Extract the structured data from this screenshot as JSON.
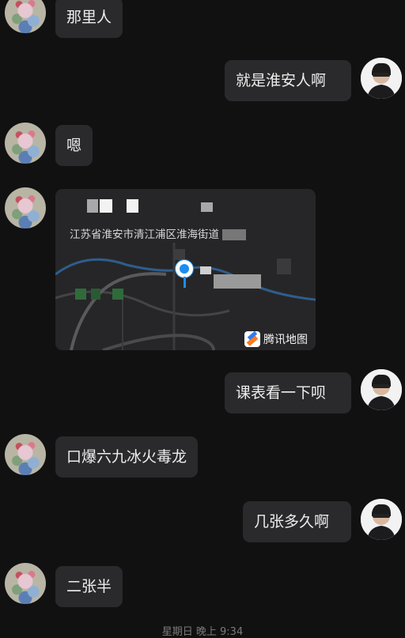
{
  "messages": [
    {
      "side": "left",
      "text": "那里人"
    },
    {
      "side": "right",
      "text": "就是淮安人啊"
    },
    {
      "side": "left",
      "text": "嗯"
    },
    {
      "side": "left",
      "type": "location",
      "address": "江苏省淮安市清江浦区淮海街道",
      "provider": "腾讯地图"
    },
    {
      "side": "right",
      "text": "课表看一下呗"
    },
    {
      "side": "left",
      "text": "口爆六九冰火毒龙"
    },
    {
      "side": "right",
      "text": "几张多久啊"
    },
    {
      "side": "left",
      "text": "二张半"
    }
  ],
  "footer": {
    "time_text": "星期日 晚上 9:34"
  },
  "colors": {
    "background": "#111112",
    "bubble": "#2a2a2c",
    "pin": "#1d8df0"
  }
}
